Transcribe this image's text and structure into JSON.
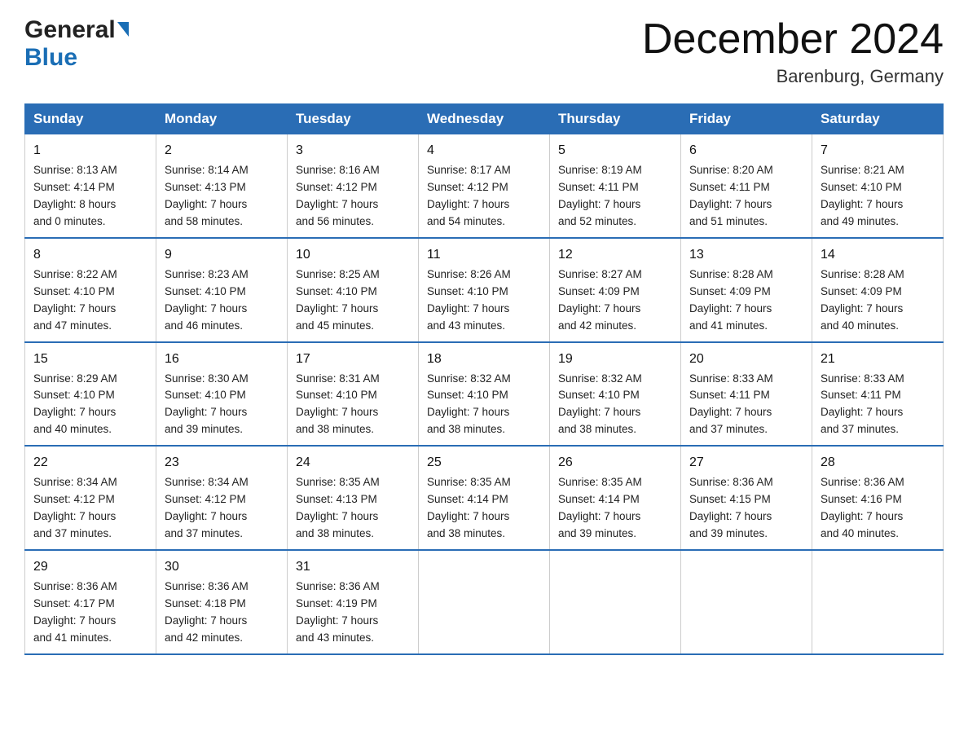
{
  "logo": {
    "line1": "General",
    "line2": "Blue"
  },
  "header": {
    "title": "December 2024",
    "location": "Barenburg, Germany"
  },
  "weekdays": [
    "Sunday",
    "Monday",
    "Tuesday",
    "Wednesday",
    "Thursday",
    "Friday",
    "Saturday"
  ],
  "weeks": [
    [
      {
        "day": "1",
        "info": "Sunrise: 8:13 AM\nSunset: 4:14 PM\nDaylight: 8 hours\nand 0 minutes."
      },
      {
        "day": "2",
        "info": "Sunrise: 8:14 AM\nSunset: 4:13 PM\nDaylight: 7 hours\nand 58 minutes."
      },
      {
        "day": "3",
        "info": "Sunrise: 8:16 AM\nSunset: 4:12 PM\nDaylight: 7 hours\nand 56 minutes."
      },
      {
        "day": "4",
        "info": "Sunrise: 8:17 AM\nSunset: 4:12 PM\nDaylight: 7 hours\nand 54 minutes."
      },
      {
        "day": "5",
        "info": "Sunrise: 8:19 AM\nSunset: 4:11 PM\nDaylight: 7 hours\nand 52 minutes."
      },
      {
        "day": "6",
        "info": "Sunrise: 8:20 AM\nSunset: 4:11 PM\nDaylight: 7 hours\nand 51 minutes."
      },
      {
        "day": "7",
        "info": "Sunrise: 8:21 AM\nSunset: 4:10 PM\nDaylight: 7 hours\nand 49 minutes."
      }
    ],
    [
      {
        "day": "8",
        "info": "Sunrise: 8:22 AM\nSunset: 4:10 PM\nDaylight: 7 hours\nand 47 minutes."
      },
      {
        "day": "9",
        "info": "Sunrise: 8:23 AM\nSunset: 4:10 PM\nDaylight: 7 hours\nand 46 minutes."
      },
      {
        "day": "10",
        "info": "Sunrise: 8:25 AM\nSunset: 4:10 PM\nDaylight: 7 hours\nand 45 minutes."
      },
      {
        "day": "11",
        "info": "Sunrise: 8:26 AM\nSunset: 4:10 PM\nDaylight: 7 hours\nand 43 minutes."
      },
      {
        "day": "12",
        "info": "Sunrise: 8:27 AM\nSunset: 4:09 PM\nDaylight: 7 hours\nand 42 minutes."
      },
      {
        "day": "13",
        "info": "Sunrise: 8:28 AM\nSunset: 4:09 PM\nDaylight: 7 hours\nand 41 minutes."
      },
      {
        "day": "14",
        "info": "Sunrise: 8:28 AM\nSunset: 4:09 PM\nDaylight: 7 hours\nand 40 minutes."
      }
    ],
    [
      {
        "day": "15",
        "info": "Sunrise: 8:29 AM\nSunset: 4:10 PM\nDaylight: 7 hours\nand 40 minutes."
      },
      {
        "day": "16",
        "info": "Sunrise: 8:30 AM\nSunset: 4:10 PM\nDaylight: 7 hours\nand 39 minutes."
      },
      {
        "day": "17",
        "info": "Sunrise: 8:31 AM\nSunset: 4:10 PM\nDaylight: 7 hours\nand 38 minutes."
      },
      {
        "day": "18",
        "info": "Sunrise: 8:32 AM\nSunset: 4:10 PM\nDaylight: 7 hours\nand 38 minutes."
      },
      {
        "day": "19",
        "info": "Sunrise: 8:32 AM\nSunset: 4:10 PM\nDaylight: 7 hours\nand 38 minutes."
      },
      {
        "day": "20",
        "info": "Sunrise: 8:33 AM\nSunset: 4:11 PM\nDaylight: 7 hours\nand 37 minutes."
      },
      {
        "day": "21",
        "info": "Sunrise: 8:33 AM\nSunset: 4:11 PM\nDaylight: 7 hours\nand 37 minutes."
      }
    ],
    [
      {
        "day": "22",
        "info": "Sunrise: 8:34 AM\nSunset: 4:12 PM\nDaylight: 7 hours\nand 37 minutes."
      },
      {
        "day": "23",
        "info": "Sunrise: 8:34 AM\nSunset: 4:12 PM\nDaylight: 7 hours\nand 37 minutes."
      },
      {
        "day": "24",
        "info": "Sunrise: 8:35 AM\nSunset: 4:13 PM\nDaylight: 7 hours\nand 38 minutes."
      },
      {
        "day": "25",
        "info": "Sunrise: 8:35 AM\nSunset: 4:14 PM\nDaylight: 7 hours\nand 38 minutes."
      },
      {
        "day": "26",
        "info": "Sunrise: 8:35 AM\nSunset: 4:14 PM\nDaylight: 7 hours\nand 39 minutes."
      },
      {
        "day": "27",
        "info": "Sunrise: 8:36 AM\nSunset: 4:15 PM\nDaylight: 7 hours\nand 39 minutes."
      },
      {
        "day": "28",
        "info": "Sunrise: 8:36 AM\nSunset: 4:16 PM\nDaylight: 7 hours\nand 40 minutes."
      }
    ],
    [
      {
        "day": "29",
        "info": "Sunrise: 8:36 AM\nSunset: 4:17 PM\nDaylight: 7 hours\nand 41 minutes."
      },
      {
        "day": "30",
        "info": "Sunrise: 8:36 AM\nSunset: 4:18 PM\nDaylight: 7 hours\nand 42 minutes."
      },
      {
        "day": "31",
        "info": "Sunrise: 8:36 AM\nSunset: 4:19 PM\nDaylight: 7 hours\nand 43 minutes."
      },
      {
        "day": "",
        "info": ""
      },
      {
        "day": "",
        "info": ""
      },
      {
        "day": "",
        "info": ""
      },
      {
        "day": "",
        "info": ""
      }
    ]
  ]
}
